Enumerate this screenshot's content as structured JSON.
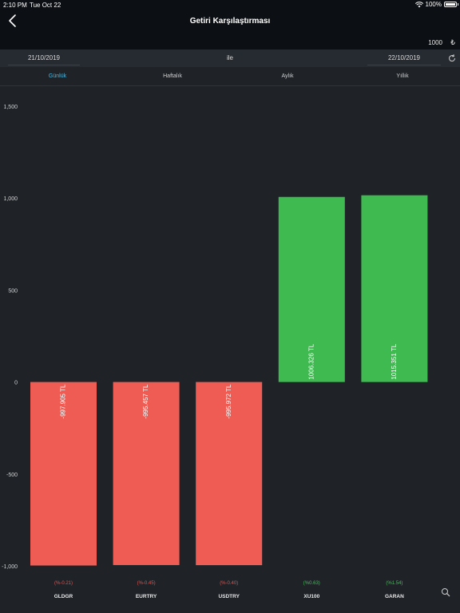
{
  "status": {
    "time": "2:10 PM",
    "date": "Tue Oct 22",
    "battery": "100%",
    "battery_level": 1.0
  },
  "header": {
    "title": "Getiri Karşılaştırması"
  },
  "amount": {
    "value": "1000",
    "currency": "₺"
  },
  "dates": {
    "start": "21/10/2019",
    "connector": "ile",
    "end": "22/10/2019"
  },
  "tabs": [
    {
      "label": "Günlük",
      "active": true
    },
    {
      "label": "Haftalık",
      "active": false
    },
    {
      "label": "Aylık",
      "active": false
    },
    {
      "label": "Yıllık",
      "active": false
    }
  ],
  "colors": {
    "negative": "#ee5c54",
    "positive": "#3fba50",
    "negative_text": "#d9534f",
    "positive_text": "#48b85a",
    "tab_active": "#4fb5dc"
  },
  "chart_data": {
    "type": "bar",
    "categories": [
      "GLDGR",
      "EURTRY",
      "USDTRY",
      "XU100",
      "GARAN"
    ],
    "values": [
      -997.905,
      -995.457,
      -995.972,
      1006.326,
      1015.351
    ],
    "value_labels": [
      "-997.905 TL",
      "-995.457 TL",
      "-995.972 TL",
      "1006.326 TL",
      "1015.351 TL"
    ],
    "percent_labels": [
      "(%-0.21)",
      "(%-0.45)",
      "(%-0.40)",
      "(%0.63)",
      "(%1.54)"
    ],
    "yticks": [
      1500,
      1000,
      500,
      0,
      -500,
      -1000
    ],
    "ytick_labels": [
      "1,500",
      "1,000",
      "500",
      "0",
      "-500",
      "-1,000"
    ],
    "ylim": [
      -1000,
      1500
    ]
  }
}
